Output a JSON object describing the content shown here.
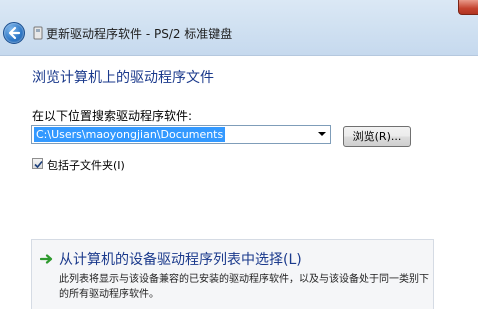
{
  "window": {
    "title": "更新驱动程序软件 - PS/2 标准键盘"
  },
  "icons": {
    "back": "back-arrow-icon",
    "title_device": "device-icon",
    "close": "close-icon",
    "checkbox": "checkmark-icon",
    "pick": "green-arrow-icon"
  },
  "main": {
    "heading": "浏览计算机上的驱动程序文件",
    "search_label": "在以下位置搜索驱动程序软件:",
    "path_value": "C:\\Users\\maoyongjian\\Documents",
    "browse_label": "浏览(R)...",
    "include_subfolders": {
      "label": "包括子文件夹(I)",
      "checked": true
    }
  },
  "pick_option": {
    "title": "从计算机的设备驱动程序列表中选择(L)",
    "description": "此列表将显示与该设备兼容的已安装的驱动程序软件，以及与该设备处于同一类别下的所有驱动程序软件。"
  },
  "colors": {
    "heading_blue": "#1b3a8c",
    "selection_blue": "#3399ff",
    "titlebar": "#cfe0f1"
  }
}
